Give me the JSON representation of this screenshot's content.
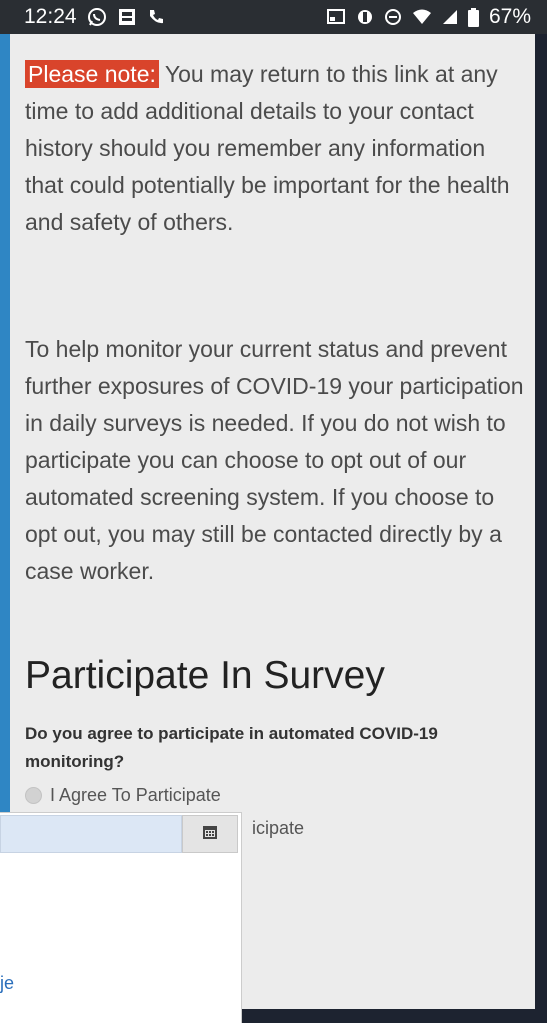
{
  "status_bar": {
    "time": "12:24",
    "battery": "67%",
    "left_icons": [
      "whatsapp-icon",
      "gallery-icon",
      "phone-icon"
    ],
    "right_icons": [
      "cast-icon",
      "data-saver-icon",
      "dnd-icon",
      "wifi-icon",
      "signal-icon",
      "battery-icon"
    ]
  },
  "notice": {
    "label": "Please note:",
    "text": " You may return to this link at any time to add additional details to your contact history should you remember any information that could potentially be important for the health and safety of others."
  },
  "info_paragraph": "To help monitor your current status and prevent further exposures of COVID-19 your participation in daily surveys is needed. If you do not wish to participate you can choose to opt out of our automated screening system. If you choose to opt out, you may still be contacted directly by a case worker.",
  "survey": {
    "title": "Participate In Survey",
    "question": "Do you agree to participate in automated COVID-19 monitoring?",
    "options": [
      "I Agree To Participate",
      "icipate"
    ]
  },
  "overlay": {
    "date_value": "",
    "link_text": "je"
  },
  "colors": {
    "accent_frame": "#2f86c4",
    "note_label_bg": "#d9442b",
    "link": "#2a6ebb"
  }
}
